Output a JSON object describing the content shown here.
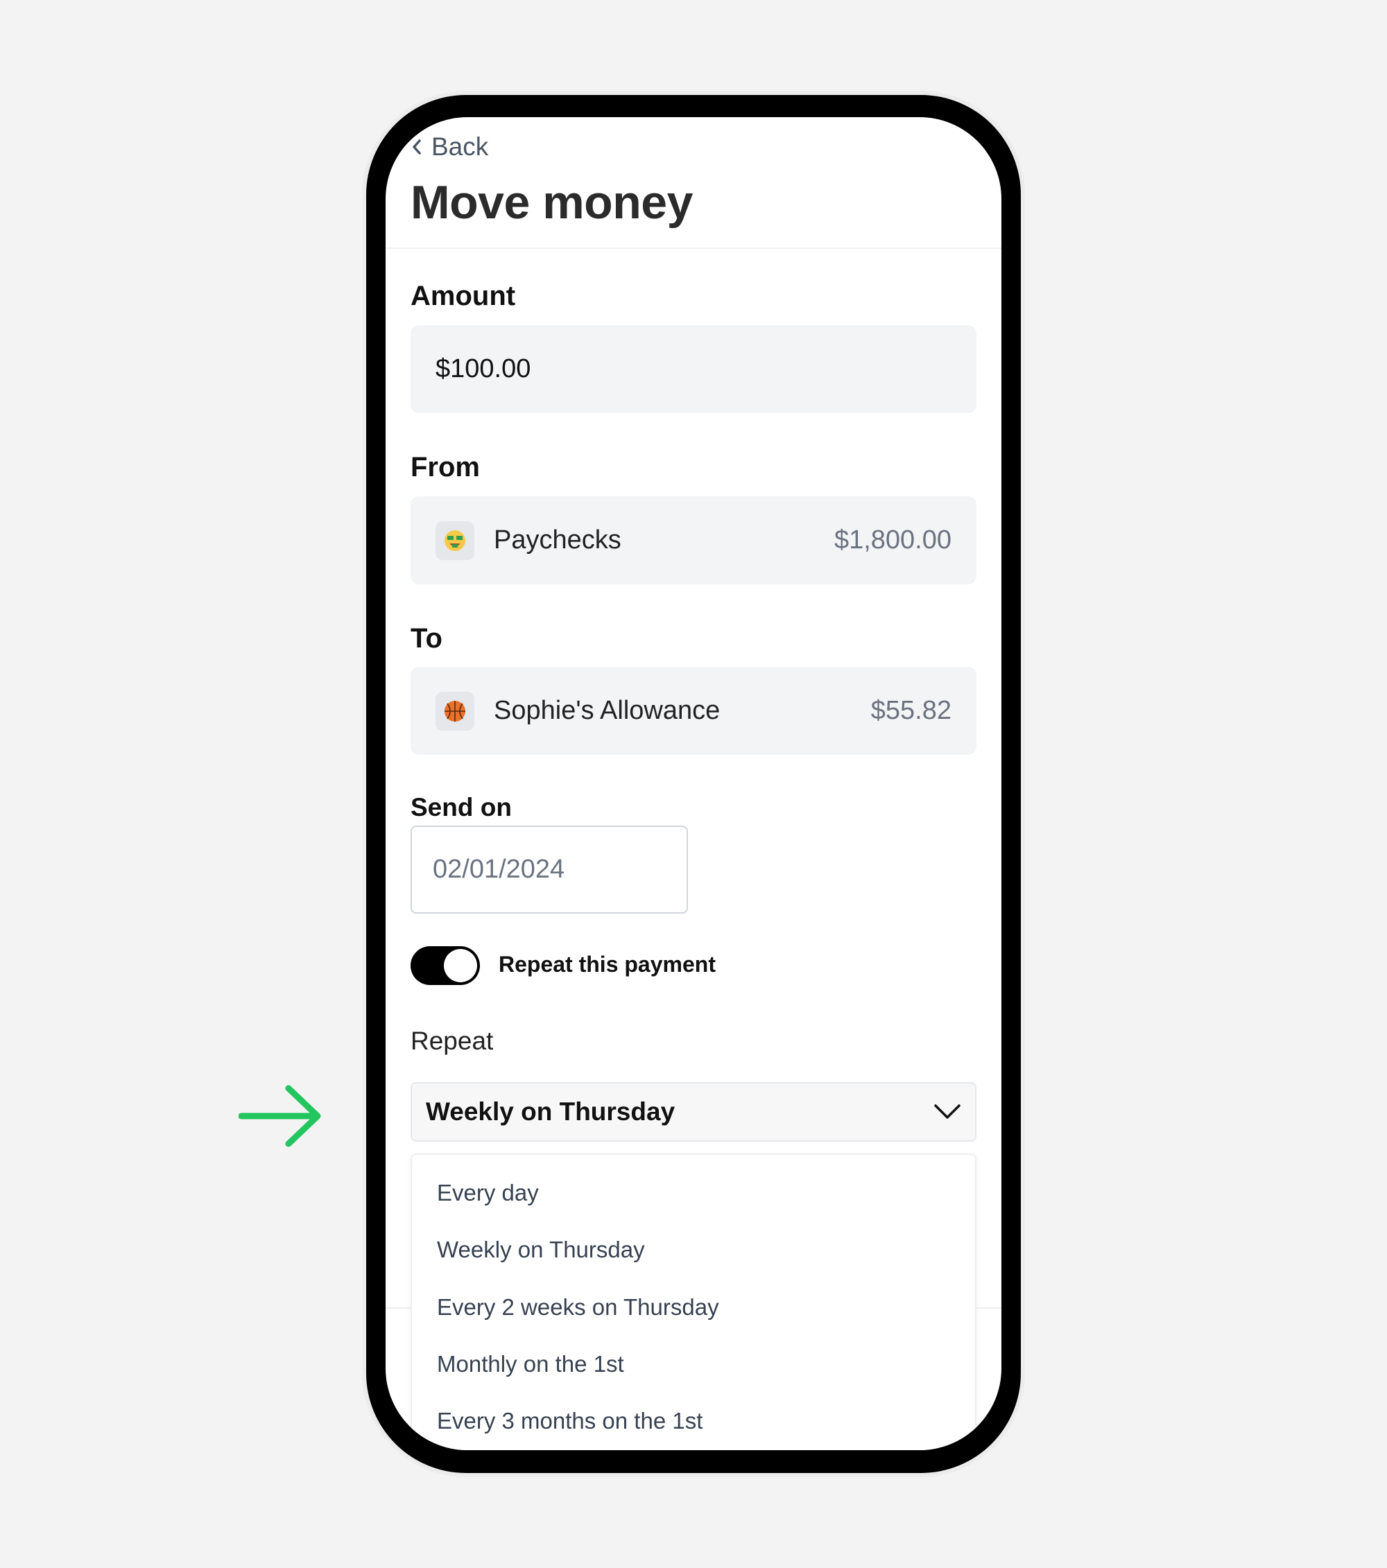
{
  "colors": {
    "background": "#f3f3f3",
    "accent_arrow": "#22c55e",
    "toggle_on": "#000000",
    "field_bg": "#f3f4f6",
    "muted_text": "#6b7280"
  },
  "header": {
    "back_label": "Back",
    "back_icon": "chevron-left-icon",
    "title": "Move money"
  },
  "amount": {
    "label": "Amount",
    "value": "$100.00"
  },
  "from": {
    "label": "From",
    "account_name": "Paychecks",
    "balance": "$1,800.00",
    "icon": "money-mouth-face-emoji"
  },
  "to": {
    "label": "To",
    "account_name": "Sophie's Allowance",
    "balance": "$55.82",
    "icon": "basketball-emoji"
  },
  "send_on": {
    "label": "Send on",
    "value": "02/01/2024"
  },
  "repeat_toggle": {
    "label": "Repeat this payment",
    "on": true
  },
  "repeat": {
    "label": "Repeat",
    "selected": "Weekly on Thursday",
    "options": [
      "Every day",
      "Weekly on Thursday",
      "Every 2 weeks on Thursday",
      "Monthly on the 1st",
      "Every 3 months on the 1st"
    ]
  },
  "annotation": {
    "icon": "arrow-right-icon"
  }
}
